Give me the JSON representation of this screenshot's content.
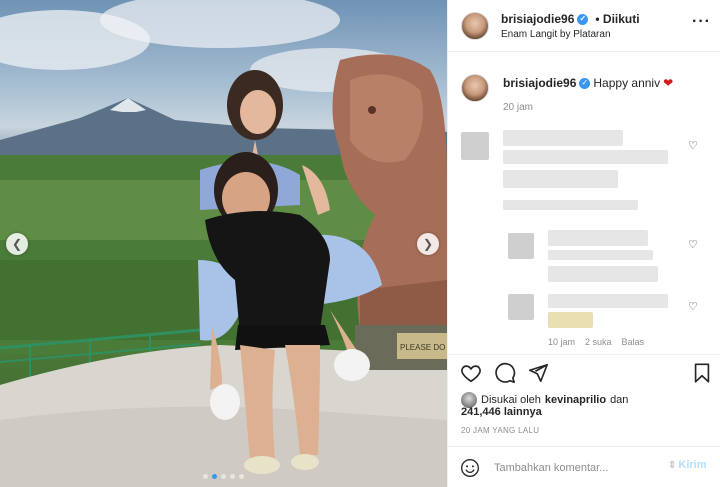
{
  "post": {
    "username": "brisiajodie96",
    "follow_state": "• Diikuti",
    "location": "Enam Langit by Plataran",
    "more_icon": "more-horizontal-icon"
  },
  "caption": {
    "username": "brisiajodie96",
    "text": "Happy anniv",
    "emoji": "❤",
    "time": "20 jam"
  },
  "comment_meta": {
    "time": "10 jam",
    "likes": "2 suka",
    "reply": "Balas"
  },
  "actions": {
    "like_icon": "heart-icon",
    "comment_icon": "comment-icon",
    "share_icon": "send-icon",
    "save_icon": "bookmark-icon"
  },
  "likes": {
    "prefix": "Disukai oleh",
    "user": "kevinaprilio",
    "conj": "dan",
    "count": "241,446 lainnya"
  },
  "timestamp": "20 JAM YANG LALU",
  "comment_box": {
    "placeholder": "Tambahkan komentar...",
    "send_label": "Kirim"
  },
  "photo": {
    "sign_text": "PLEASE DO N"
  },
  "colors": {
    "accent": "#3897f0",
    "heart": "#d21c1c",
    "send_disabled": "#b2dffc"
  }
}
